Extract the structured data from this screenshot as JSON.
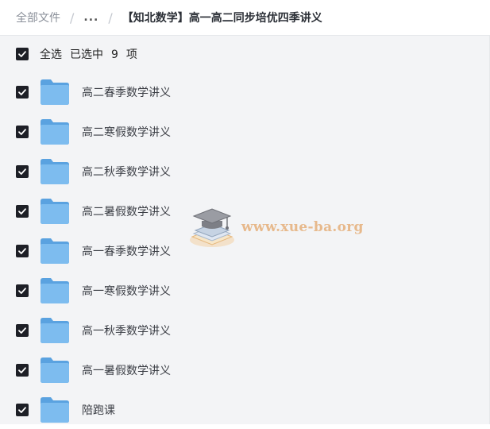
{
  "breadcrumb": {
    "root": "全部文件",
    "ellipsis": "...",
    "current": "【知北数学】高一高二同步培优四季讲义"
  },
  "selection": {
    "select_all_label": "全选",
    "selected_prefix": "已选中",
    "selected_count": "9",
    "selected_suffix": "项"
  },
  "folders": [
    {
      "name": "高二春季数学讲义",
      "checked": true
    },
    {
      "name": "高二寒假数学讲义",
      "checked": true
    },
    {
      "name": "高二秋季数学讲义",
      "checked": true
    },
    {
      "name": "高二暑假数学讲义",
      "checked": true
    },
    {
      "name": "高一春季数学讲义",
      "checked": true
    },
    {
      "name": "高一寒假数学讲义",
      "checked": true
    },
    {
      "name": "高一秋季数学讲义",
      "checked": true
    },
    {
      "name": "高一暑假数学讲义",
      "checked": true
    },
    {
      "name": "陪跑课",
      "checked": true
    }
  ],
  "watermark": {
    "text": "www.xue-ba.org"
  },
  "colors": {
    "checkbox": "#1d1f26",
    "folder": "#6fb1e8",
    "watermark": "#e7b98c"
  },
  "icons": {
    "checkbox": "checkbox-checked-icon",
    "folder": "folder-icon",
    "logo": "graduation-cap-books-logo"
  }
}
